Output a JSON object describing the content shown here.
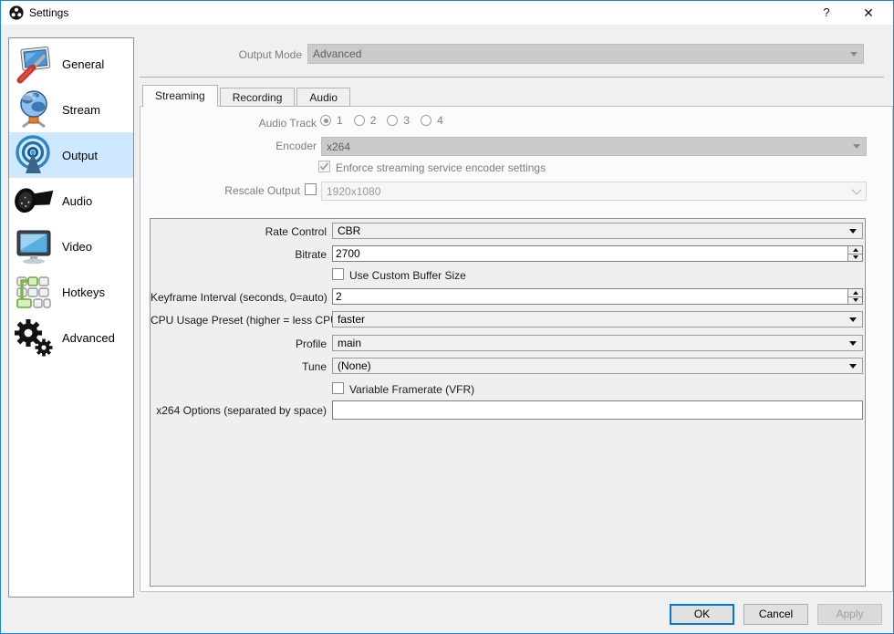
{
  "window": {
    "title": "Settings",
    "help_button": "?",
    "close_button": "✕"
  },
  "colors": {
    "accent_blue": "#0078d7",
    "window_border": "#2085d6",
    "sidebar_selected_bg": "#cde8ff",
    "dialog_bg": "#f0f0f0",
    "pane_bg": "#fbfbfb",
    "disabled_field_bg": "#cbcbcb"
  },
  "sidebar": {
    "items": [
      {
        "label": "General",
        "icon": "general-icon",
        "selected": false
      },
      {
        "label": "Stream",
        "icon": "stream-icon",
        "selected": false
      },
      {
        "label": "Output",
        "icon": "output-icon",
        "selected": true
      },
      {
        "label": "Audio",
        "icon": "audio-icon",
        "selected": false
      },
      {
        "label": "Video",
        "icon": "video-icon",
        "selected": false
      },
      {
        "label": "Hotkeys",
        "icon": "hotkeys-icon",
        "selected": false
      },
      {
        "label": "Advanced",
        "icon": "advanced-icon",
        "selected": false
      }
    ]
  },
  "output_mode": {
    "label": "Output Mode",
    "value": "Advanced",
    "disabled": true
  },
  "tabs": [
    {
      "label": "Streaming",
      "active": true
    },
    {
      "label": "Recording",
      "active": false
    },
    {
      "label": "Audio",
      "active": false
    }
  ],
  "streaming": {
    "audio_track": {
      "label": "Audio Track",
      "options": [
        "1",
        "2",
        "3",
        "4"
      ],
      "selected": "1",
      "disabled": true
    },
    "encoder": {
      "label": "Encoder",
      "value": "x264",
      "disabled": true
    },
    "enforce": {
      "label": "Enforce streaming service encoder settings",
      "checked": true,
      "disabled": true
    },
    "rescale": {
      "label": "Rescale Output",
      "checked": false,
      "value": "1920x1080",
      "disabled": true
    },
    "group": {
      "rate_control": {
        "label": "Rate Control",
        "value": "CBR"
      },
      "bitrate": {
        "label": "Bitrate",
        "value": "2700"
      },
      "custom_buffer": {
        "label": "Use Custom Buffer Size",
        "checked": false
      },
      "keyframe": {
        "label": "Keyframe Interval (seconds, 0=auto)",
        "value": "2"
      },
      "cpu_preset": {
        "label": "CPU Usage Preset (higher = less CPU)",
        "value": "faster"
      },
      "profile": {
        "label": "Profile",
        "value": "main"
      },
      "tune": {
        "label": "Tune",
        "value": "(None)"
      },
      "vfr": {
        "label": "Variable Framerate (VFR)",
        "checked": false
      },
      "x264_options": {
        "label": "x264 Options (separated by space)",
        "value": ""
      }
    }
  },
  "buttons": {
    "ok": "OK",
    "cancel": "Cancel",
    "apply": "Apply",
    "apply_disabled": true
  }
}
